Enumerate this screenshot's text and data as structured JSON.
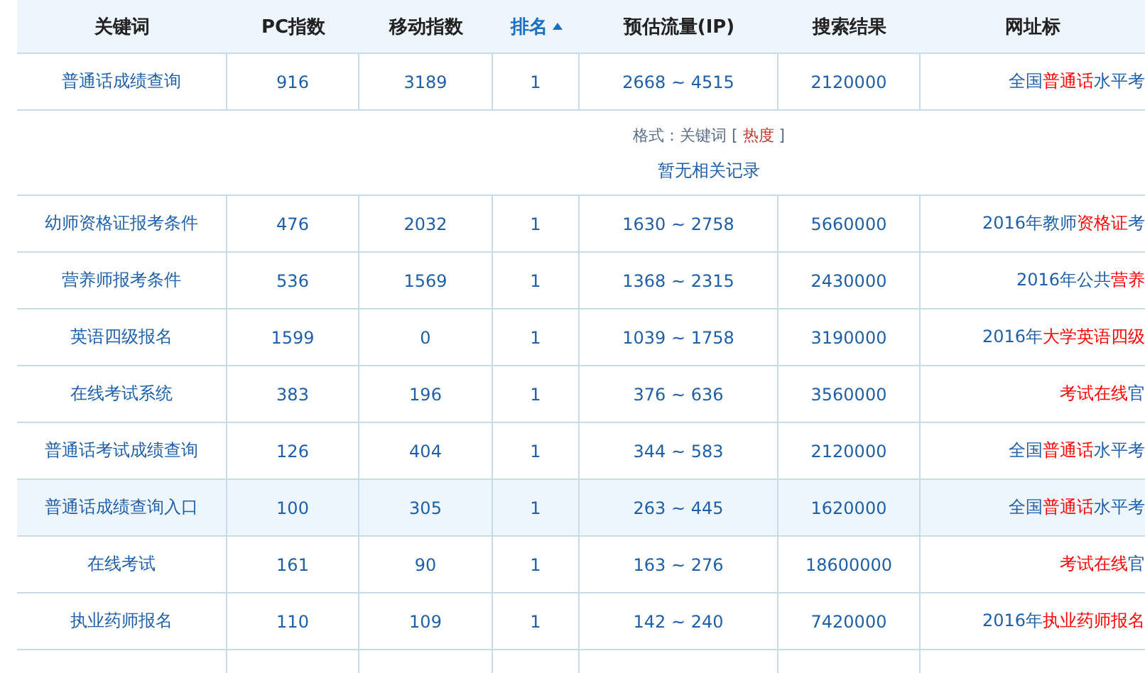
{
  "table": {
    "columns": [
      {
        "label": "关键词",
        "sorted": false
      },
      {
        "label": "PC指数",
        "sorted": false
      },
      {
        "label": "移动指数",
        "sorted": false
      },
      {
        "label": "排名",
        "sorted": true
      },
      {
        "label": "预估流量(IP)",
        "sorted": false
      },
      {
        "label": "搜索结果",
        "sorted": false
      },
      {
        "label": "网址标",
        "sorted": false
      }
    ],
    "top_rows": [
      {
        "keyword": "普通话成绩查询",
        "pc": "916",
        "mobile": "3189",
        "rank": "1",
        "traffic": "2668 ~ 4515",
        "results": "2120000",
        "highlighted": false,
        "title": [
          {
            "text": "全国",
            "hit": false
          },
          {
            "text": "普通话",
            "hit": true
          },
          {
            "text": "水平考",
            "hit": false
          }
        ]
      }
    ],
    "info": {
      "format_label": "格式：关键词 [",
      "format_hot": "热度",
      "format_end": "]",
      "empty": "暂无相关记录"
    },
    "rows": [
      {
        "keyword": "幼师资格证报考条件",
        "pc": "476",
        "mobile": "2032",
        "rank": "1",
        "traffic": "1630 ~ 2758",
        "results": "5660000",
        "highlighted": false,
        "title": [
          {
            "text": "2016年教师",
            "hit": false
          },
          {
            "text": "资格证",
            "hit": true
          },
          {
            "text": "考",
            "hit": false
          }
        ]
      },
      {
        "keyword": "营养师报考条件",
        "pc": "536",
        "mobile": "1569",
        "rank": "1",
        "traffic": "1368 ~ 2315",
        "results": "2430000",
        "highlighted": false,
        "title": [
          {
            "text": "2016年公共",
            "hit": false
          },
          {
            "text": "营养",
            "hit": true
          }
        ]
      },
      {
        "keyword": "英语四级报名",
        "pc": "1599",
        "mobile": "0",
        "rank": "1",
        "traffic": "1039 ~ 1758",
        "results": "3190000",
        "highlighted": false,
        "title": [
          {
            "text": "2016年",
            "hit": false
          },
          {
            "text": "大学英语四级",
            "hit": true
          }
        ]
      },
      {
        "keyword": "在线考试系统",
        "pc": "383",
        "mobile": "196",
        "rank": "1",
        "traffic": "376 ~ 636",
        "results": "3560000",
        "highlighted": false,
        "title": [
          {
            "text": "考试在线",
            "hit": true
          },
          {
            "text": "官",
            "hit": false
          }
        ]
      },
      {
        "keyword": "普通话考试成绩查询",
        "pc": "126",
        "mobile": "404",
        "rank": "1",
        "traffic": "344 ~ 583",
        "results": "2120000",
        "highlighted": false,
        "title": [
          {
            "text": "全国",
            "hit": false
          },
          {
            "text": "普通话",
            "hit": true
          },
          {
            "text": "水平考",
            "hit": false
          }
        ]
      },
      {
        "keyword": "普通话成绩查询入口",
        "pc": "100",
        "mobile": "305",
        "rank": "1",
        "traffic": "263 ~ 445",
        "results": "1620000",
        "highlighted": true,
        "title": [
          {
            "text": "全国",
            "hit": false
          },
          {
            "text": "普通话",
            "hit": true
          },
          {
            "text": "水平考",
            "hit": false
          }
        ]
      },
      {
        "keyword": "在线考试",
        "pc": "161",
        "mobile": "90",
        "rank": "1",
        "traffic": "163 ~ 276",
        "results": "18600000",
        "highlighted": false,
        "title": [
          {
            "text": "考试在线",
            "hit": true
          },
          {
            "text": "官",
            "hit": false
          }
        ]
      },
      {
        "keyword": "执业药师报名",
        "pc": "110",
        "mobile": "109",
        "rank": "1",
        "traffic": "142 ~ 240",
        "results": "7420000",
        "highlighted": false,
        "title": [
          {
            "text": "2016年",
            "hit": false
          },
          {
            "text": "执业药师报名",
            "hit": true
          }
        ]
      }
    ]
  }
}
